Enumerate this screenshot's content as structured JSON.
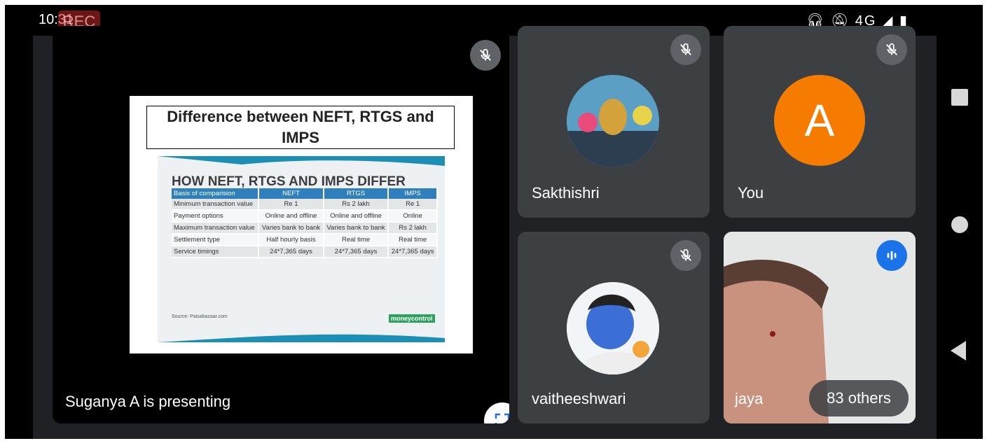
{
  "status_bar": {
    "time": "10:31",
    "rec_label": "REC",
    "icons": [
      "headset-icon",
      "mute-notification-icon",
      "4g-signal-icon",
      "battery-icon"
    ],
    "network": "4G"
  },
  "presentation": {
    "presenter_text": "Suganya A is presenting",
    "slide": {
      "title": "Difference between NEFT, RTGS and IMPS",
      "heading": "HOW NEFT, RTGS AND IMPS DIFFER",
      "table": {
        "headers": [
          "Basis of comparision",
          "NEFT",
          "RTGS",
          "IMPS"
        ],
        "rows": [
          [
            "Minimum transaction value",
            "Re 1",
            "Rs 2 lakh",
            "Re 1"
          ],
          [
            "Payment options",
            "Online and offline",
            "Online and offline",
            "Online"
          ],
          [
            "Maximum transaction value",
            "Varies bank to bank",
            "Varies bank to bank",
            "Rs 2 lakh"
          ],
          [
            "Settlement type",
            "Half hourly basis",
            "Real time",
            "Real time"
          ],
          [
            "Service timings",
            "24*7,365 days",
            "24*7,365 days",
            "24*7,365 days"
          ]
        ]
      },
      "source": "Source: Paisabazaar.com",
      "brand": "moneycontrol"
    }
  },
  "participants": [
    {
      "name": "Sakthishri",
      "muted": true
    },
    {
      "name": "You",
      "initial": "A",
      "avatar_color": "#f57c00",
      "muted": true
    },
    {
      "name": "vaitheeshwari",
      "muted": true
    },
    {
      "name": "jaya",
      "speaking": true
    }
  ],
  "others_label": "83 others",
  "colors": {
    "tile_bg": "#3c4043",
    "stage_bg": "#202124",
    "speaking_blue": "#1a73e8"
  }
}
